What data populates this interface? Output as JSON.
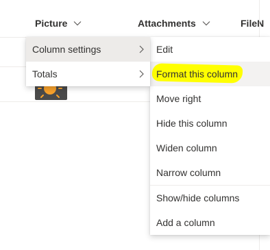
{
  "columns": [
    {
      "label": "Picture"
    },
    {
      "label": "Attachments"
    },
    {
      "label": "FileN"
    }
  ],
  "context_menu": {
    "items": [
      {
        "label": "Column settings",
        "active": true
      },
      {
        "label": "Totals",
        "active": false
      }
    ]
  },
  "submenu": {
    "items": [
      {
        "label": "Edit"
      },
      {
        "label": "Format this column",
        "highlighted": true
      },
      {
        "label": "Move right"
      },
      {
        "label": "Hide this column"
      },
      {
        "label": "Widen column"
      },
      {
        "label": "Narrow column"
      },
      {
        "label": "Show/hide columns"
      },
      {
        "label": "Add a column"
      }
    ]
  },
  "colors": {
    "highlight": "#ffff00",
    "menu_active_bg": "#edebe9",
    "text": "#323130",
    "sun": "#f7a12b"
  },
  "icons": {
    "column_dropdown": "chevron-down-icon",
    "submenu_arrow": "chevron-right-icon",
    "thumbnail": "sun-icon"
  }
}
